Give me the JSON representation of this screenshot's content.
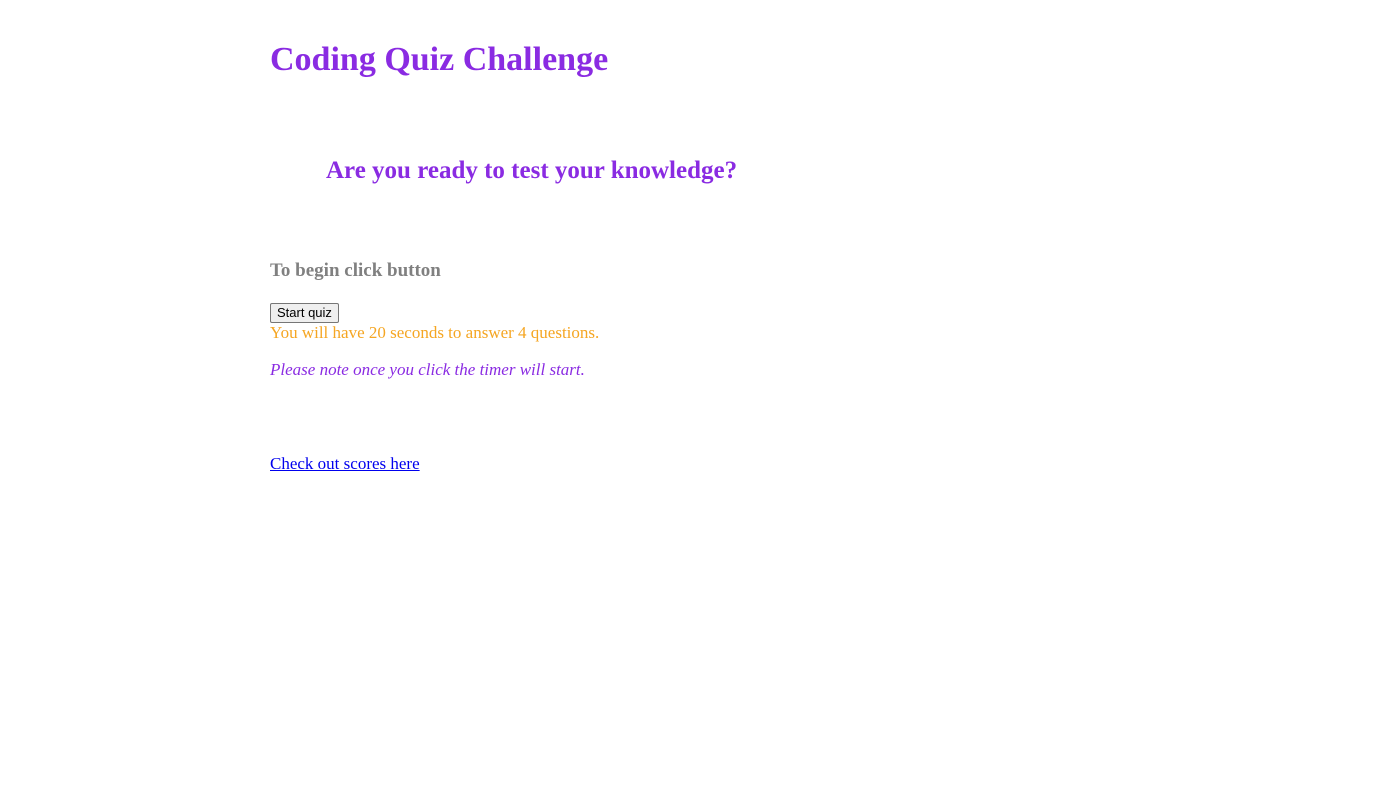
{
  "header": {
    "title": "Coding Quiz Challenge"
  },
  "intro": {
    "subtitle": "Are you ready to test your knowledge?",
    "instruction": "To begin click button",
    "start_button_label": "Start quiz",
    "info_text": "You will have 20 seconds to answer 4 questions.",
    "note_text": "Please note once you click the timer will start."
  },
  "footer": {
    "scores_link_text": "Check out scores here"
  },
  "colors": {
    "accent_purple": "#8a2be2",
    "info_orange": "#f5a623",
    "instruction_gray": "#808080",
    "link_blue": "#0000ee"
  }
}
